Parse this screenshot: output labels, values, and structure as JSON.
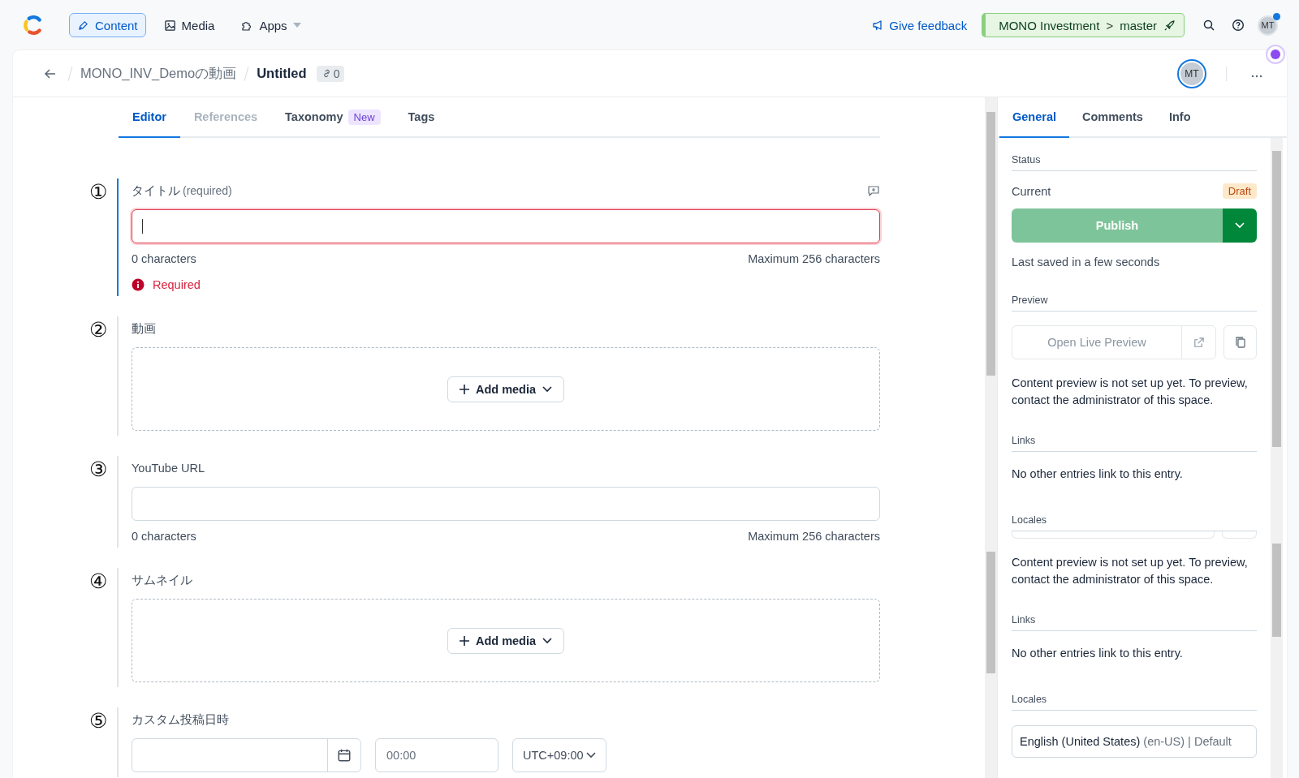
{
  "top_nav": {
    "tabs": [
      {
        "label": "Content",
        "selected": true
      },
      {
        "label": "Media",
        "selected": false
      },
      {
        "label": "Apps",
        "caret": true,
        "selected": false
      }
    ],
    "feedback": "Give feedback",
    "environment": {
      "space": "MONO Investment",
      "separator": ">",
      "branch": "master"
    },
    "avatar": "MT",
    "notification": true
  },
  "entry_header": {
    "breadcrumb": "MONO_INV_Demoの動画",
    "title": "Untitled",
    "link_count": "0",
    "avatar": "MT"
  },
  "editor_tabs": [
    {
      "label": "Editor",
      "selected": true,
      "disabled": false
    },
    {
      "label": "References",
      "selected": false,
      "disabled": true
    },
    {
      "label": "Taxonomy",
      "badge": "New",
      "selected": false,
      "disabled": false
    },
    {
      "label": "Tags",
      "selected": false,
      "disabled": false
    }
  ],
  "fields": [
    {
      "kind": "text",
      "marker": "①",
      "label": "タイトル",
      "required_note": "(required)",
      "focused": true,
      "invalid": true,
      "count": "0 characters",
      "maximum": "Maximum 256 characters",
      "error": "Required"
    },
    {
      "kind": "media",
      "marker": "②",
      "label": "動画",
      "button": "Add media"
    },
    {
      "kind": "text",
      "marker": "③",
      "label": "YouTube URL",
      "focused": false,
      "invalid": false,
      "count": "0 characters",
      "maximum": "Maximum 256 characters"
    },
    {
      "kind": "media",
      "marker": "④",
      "label": "サムネイル",
      "button": "Add media"
    },
    {
      "kind": "datetime",
      "marker": "⑤",
      "label": "カスタム投稿日時",
      "time": "00:00",
      "timezone": "UTC+09:00"
    }
  ],
  "sidebar": {
    "tabs": [
      {
        "label": "General",
        "selected": true
      },
      {
        "label": "Comments",
        "selected": false
      },
      {
        "label": "Info",
        "selected": false
      }
    ],
    "sections": [
      {
        "kind": "status",
        "heading": "Status",
        "current_label": "Current",
        "badge": "Draft",
        "publish": "Publish",
        "saved": "Last saved in a few seconds"
      },
      {
        "kind": "preview",
        "heading": "Preview",
        "button": "Open Live Preview",
        "note": "Content preview is not set up yet. To preview, contact the administrator of this space."
      },
      {
        "kind": "links",
        "heading": "Links",
        "note": "No other entries link to this entry."
      },
      {
        "kind": "clipped-preview",
        "heading": "Locales",
        "note": "Content preview is not set up yet. To preview, contact the administrator of this space."
      },
      {
        "kind": "links",
        "heading": "Links",
        "note": "No other entries link to this entry."
      },
      {
        "kind": "locales",
        "heading": "Locales",
        "locale": "English (United States)",
        "code": "(en-US)",
        "default": "| Default"
      }
    ]
  }
}
